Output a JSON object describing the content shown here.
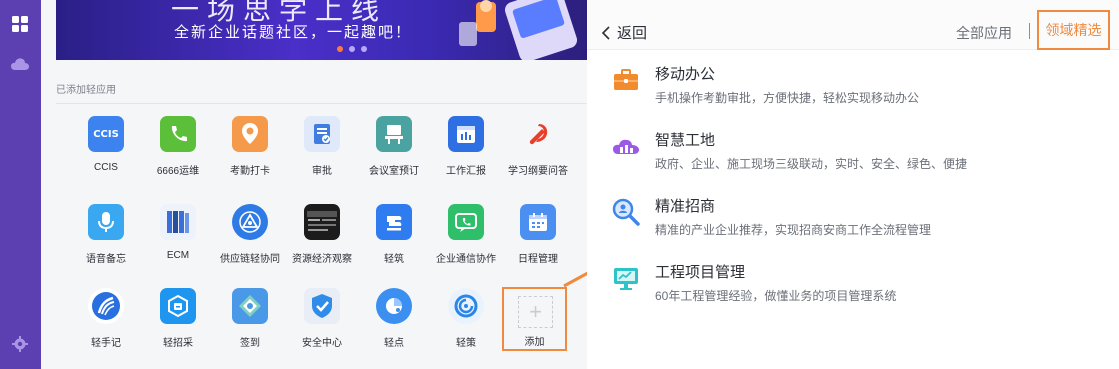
{
  "banner": {
    "title": "一场思学上线",
    "subtitle": "全新企业话题社区，一起趣吧！"
  },
  "section": {
    "added_apps_label": "已添加轻应用"
  },
  "apps": [
    {
      "label": "CCIS",
      "icon": "ccis-icon",
      "color": "#3c83f0"
    },
    {
      "label": "6666运维",
      "icon": "phone-wrench-icon",
      "color": "#5cbf3a"
    },
    {
      "label": "考勤打卡",
      "icon": "location-pin-icon",
      "color": "#f59a4b"
    },
    {
      "label": "审批",
      "icon": "document-check-icon",
      "color": "#3f7de0"
    },
    {
      "label": "会议室预订",
      "icon": "meeting-room-icon",
      "color": "#4aa3a0"
    },
    {
      "label": "工作汇报",
      "icon": "report-icon",
      "color": "#2f6fe4"
    },
    {
      "label": "学习纲要问答",
      "icon": "party-emblem-icon",
      "color": "#e83e2a"
    },
    {
      "label": "语音备忘",
      "icon": "microphone-icon",
      "color": "#3aa8f0"
    },
    {
      "label": "ECM",
      "icon": "books-icon",
      "color": "#3a6fd8"
    },
    {
      "label": "供应链轻协同",
      "icon": "network-triangle-icon",
      "color": "#2e7be6"
    },
    {
      "label": "资源经济观察",
      "icon": "economy-observe-icon",
      "color": "#222222"
    },
    {
      "label": "轻筑",
      "icon": "build-icon",
      "color": "#2f7bf0"
    },
    {
      "label": "企业通信协作",
      "icon": "chat-call-icon",
      "color": "#2fbf6a"
    },
    {
      "label": "日程管理",
      "icon": "calendar-icon",
      "color": "#4b8ff0"
    },
    {
      "label": "轻手记",
      "icon": "notebook-icon",
      "color": "#2a6fe0"
    },
    {
      "label": "轻招采",
      "icon": "procurement-icon",
      "color": "#1e96f0"
    },
    {
      "label": "签到",
      "icon": "check-in-icon",
      "color": "#4a98e8"
    },
    {
      "label": "安全中心",
      "icon": "shield-check-icon",
      "color": "#2f8ce8"
    },
    {
      "label": "轻点",
      "icon": "pie-point-icon",
      "color": "#3a8ff0"
    },
    {
      "label": "轻策",
      "icon": "strategy-icon",
      "color": "#2a86e8"
    }
  ],
  "add_tile": {
    "label": "添加",
    "symbol": "+"
  },
  "right_panel": {
    "back_label": "返回",
    "all_apps_label": "全部应用",
    "curated_label": "领域精选",
    "categories": [
      {
        "title": "移动办公",
        "desc": "手机操作考勤审批，方便快捷，轻松实现移动办公",
        "icon": "briefcase-icon",
        "color": "#f28a2e"
      },
      {
        "title": "智慧工地",
        "desc": "政府、企业、施工现场三级联动，实时、安全、绿色、便捷",
        "icon": "cloud-construction-icon",
        "color": "#9b59e6"
      },
      {
        "title": "精准招商",
        "desc": "精准的产业企业推荐，实现招商安商工作全流程管理",
        "icon": "magnify-people-icon",
        "color": "#3f86e8"
      },
      {
        "title": "工程项目管理",
        "desc": "60年工程管理经验，做懂业务的项目管理系统",
        "icon": "monitor-project-icon",
        "color": "#2ec3c8"
      }
    ]
  },
  "accent_color": "#f08a3e"
}
